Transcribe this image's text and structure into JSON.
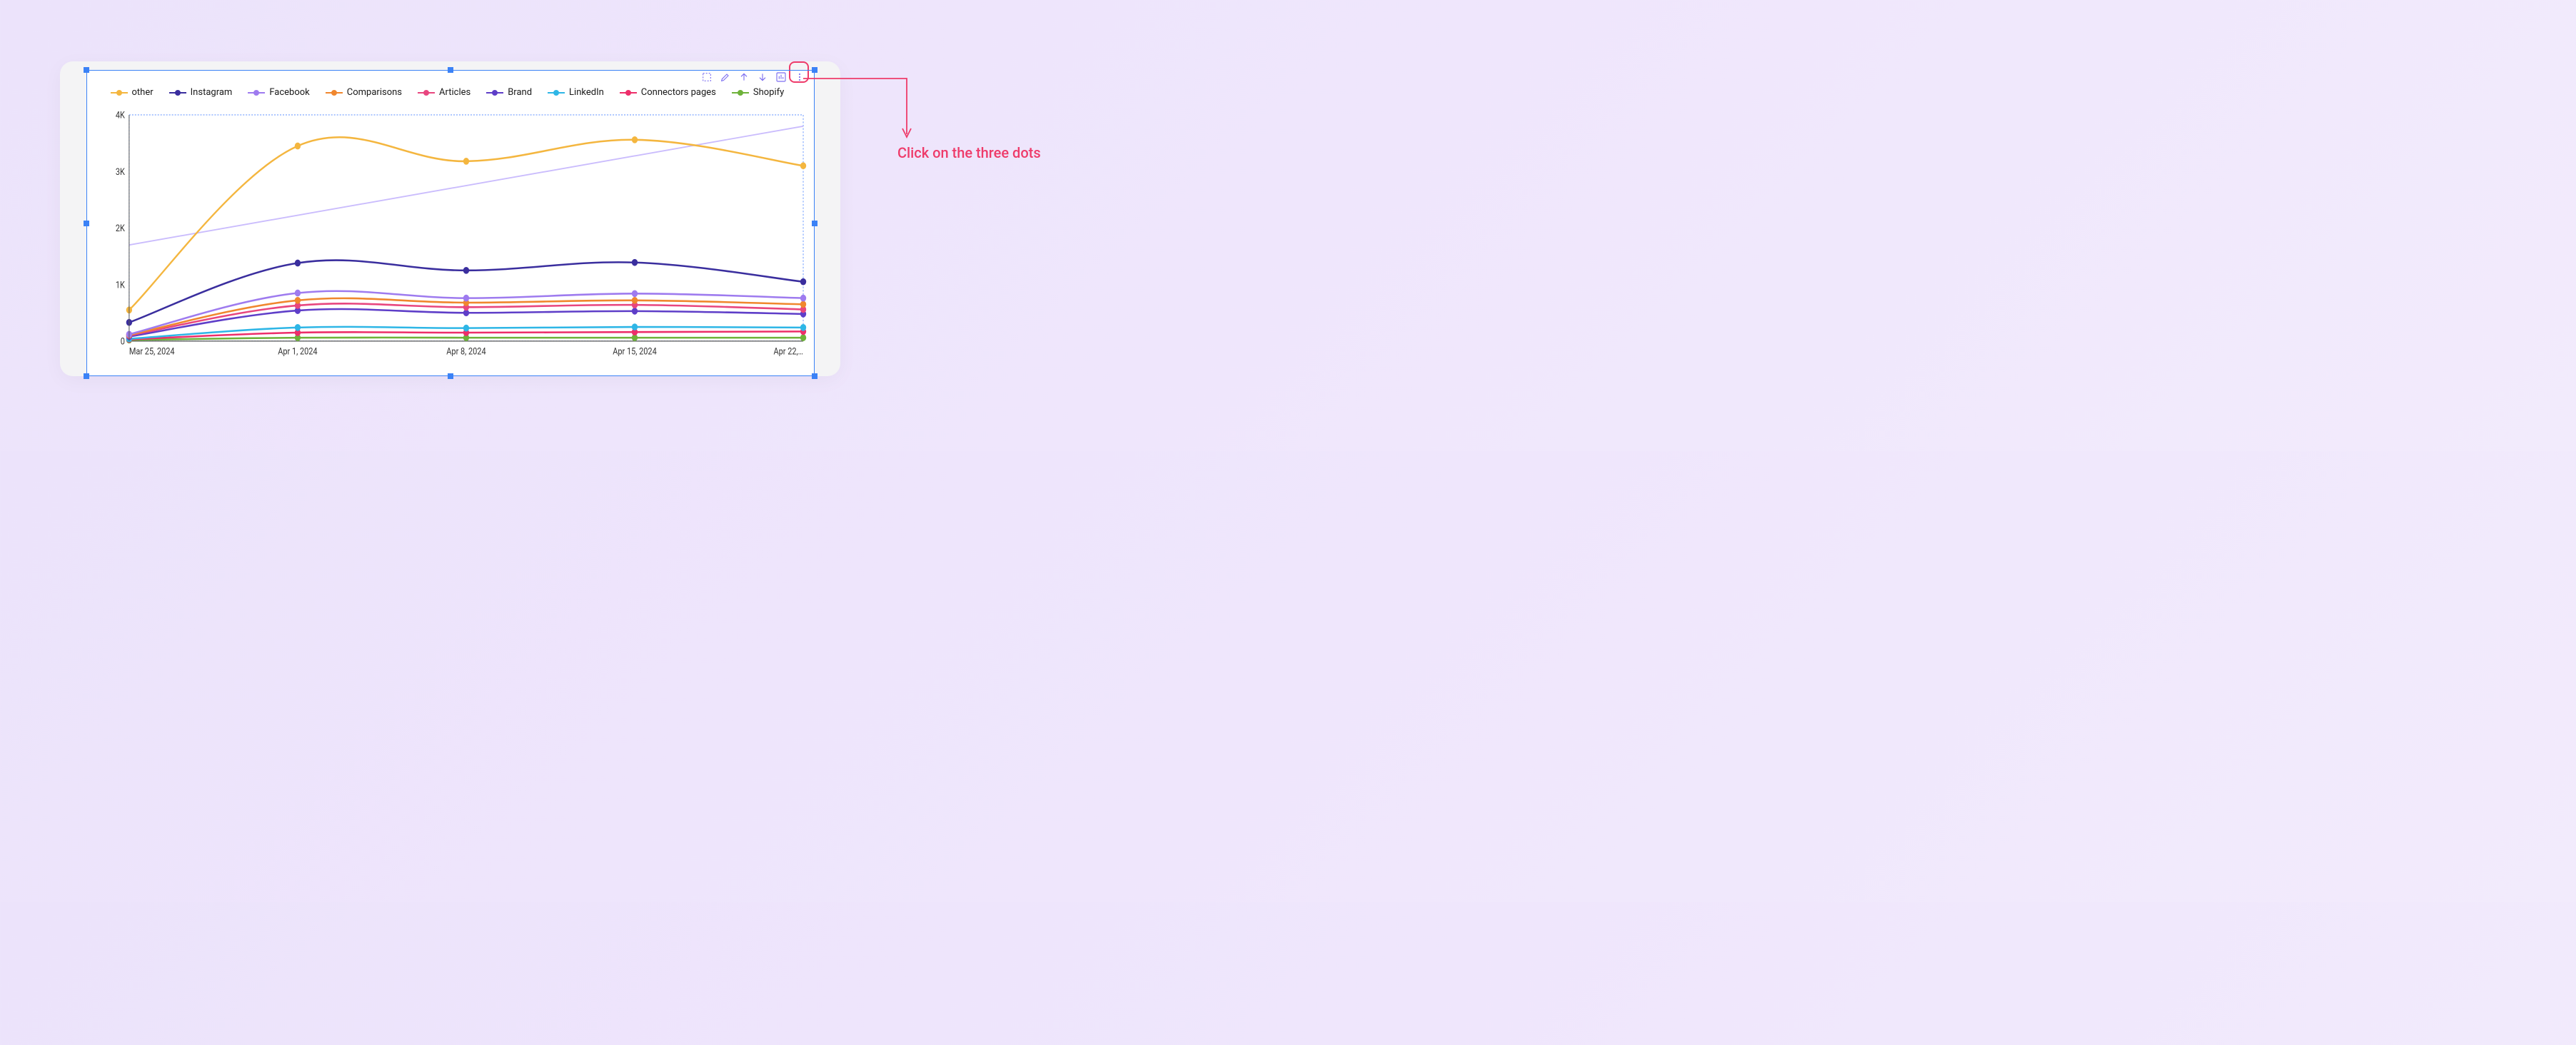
{
  "annotation": {
    "text": "Click on the three dots"
  },
  "toolbar": {
    "icons": [
      "bounding-box-icon",
      "pencil-icon",
      "arrow-up-icon",
      "arrow-down-icon",
      "chart-icon",
      "more-icon"
    ]
  },
  "chart_data": {
    "type": "line",
    "title": "",
    "xlabel": "",
    "ylabel": "",
    "categories": [
      "Mar 25, 2024",
      "Apr 1, 2024",
      "Apr 8, 2024",
      "Apr 15, 2024",
      "Apr 22,…"
    ],
    "y_ticks": [
      0,
      "1K",
      "2K",
      "3K",
      "4K"
    ],
    "ylim": [
      0,
      4000
    ],
    "trendline": {
      "start": 1700,
      "end": 3800
    },
    "series": [
      {
        "name": "other",
        "color": "#f4b63f",
        "values": [
          550,
          3450,
          3180,
          3560,
          3100
        ]
      },
      {
        "name": "Instagram",
        "color": "#3a2e9e",
        "values": [
          330,
          1380,
          1250,
          1390,
          1050
        ]
      },
      {
        "name": "Facebook",
        "color": "#9e7bef",
        "values": [
          120,
          850,
          760,
          840,
          760
        ]
      },
      {
        "name": "Comparisons",
        "color": "#f0872e",
        "values": [
          110,
          720,
          680,
          720,
          650
        ]
      },
      {
        "name": "Articles",
        "color": "#e8467f",
        "values": [
          100,
          630,
          600,
          640,
          560
        ]
      },
      {
        "name": "Brand",
        "color": "#5e3ec8",
        "values": [
          80,
          540,
          500,
          530,
          480
        ]
      },
      {
        "name": "LinkedIn",
        "color": "#2eb6e6",
        "values": [
          40,
          240,
          230,
          250,
          240
        ]
      },
      {
        "name": "Connectors pages",
        "color": "#ed2e6a",
        "values": [
          30,
          150,
          150,
          160,
          170
        ]
      },
      {
        "name": "Shopify",
        "color": "#6eb23a",
        "values": [
          20,
          60,
          60,
          60,
          60
        ]
      }
    ]
  }
}
